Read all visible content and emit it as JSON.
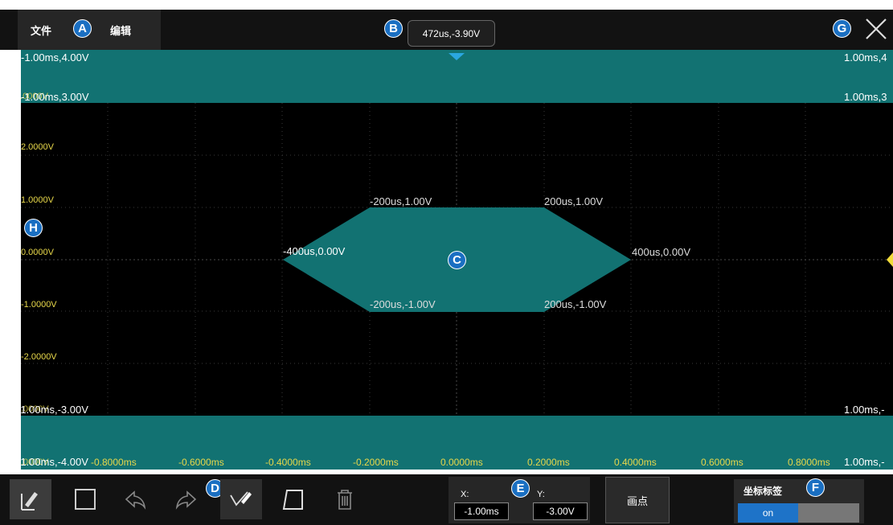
{
  "menu": {
    "file": "文件",
    "edit": "编辑"
  },
  "cursor_readout": "472us,-3.90V",
  "badges": {
    "A": "A",
    "B": "B",
    "C": "C",
    "D": "D",
    "E": "E",
    "F": "F",
    "G": "G",
    "H": "H"
  },
  "mask_upper": {
    "tl": "-1.00ms,4.00V",
    "tr": "1.00ms,4",
    "bl": "-1.00ms,3.00V",
    "br": "1.00ms,3",
    "bl_overlap": "3.0000V"
  },
  "mask_lower": {
    "tl": "-1.00ms,-3.00V",
    "tl_overlap": "-3.0000V",
    "tr": "1.00ms,-",
    "bl": "-1.00ms,-4.00V",
    "bl_overlap": "-4.0000V",
    "br": "1.00ms,-"
  },
  "polygon_labels": {
    "p1": "-400us,0.00V",
    "p2": "-200us,1.00V",
    "p3": "200us,1.00V",
    "p4": "400us,0.00V",
    "p5": "200us,-1.00V",
    "p6": "-200us,-1.00V"
  },
  "y_axis": [
    "2.0000V",
    "1.0000V",
    "0.0000V",
    "-1.0000V",
    "-2.0000V"
  ],
  "x_axis": [
    "-0.8000ms",
    "-0.6000ms",
    "-0.4000ms",
    "-0.2000ms",
    "0.0000ms",
    "0.2000ms",
    "0.4000ms",
    "0.6000ms",
    "0.8000ms"
  ],
  "coords": {
    "x_label": "X:",
    "x_value": "-1.00ms",
    "y_label": "Y:",
    "y_value": "-3.00V"
  },
  "plot_button": "画点",
  "coord_labels": {
    "title": "坐标标签",
    "on": "on"
  },
  "icons": [
    "pen-select-icon",
    "rectangle-icon",
    "undo-icon",
    "redo-icon",
    "point-pen-icon",
    "trapezoid-icon",
    "delete-icon",
    "close-icon",
    "trigger-marker-icon",
    "level-marker-icon"
  ],
  "colors": {
    "mask": "#127272",
    "polygon": "#127272",
    "axis_label": "#e8d84a",
    "badge": "#1a6fc2",
    "toggle_on": "#1e73c8"
  }
}
